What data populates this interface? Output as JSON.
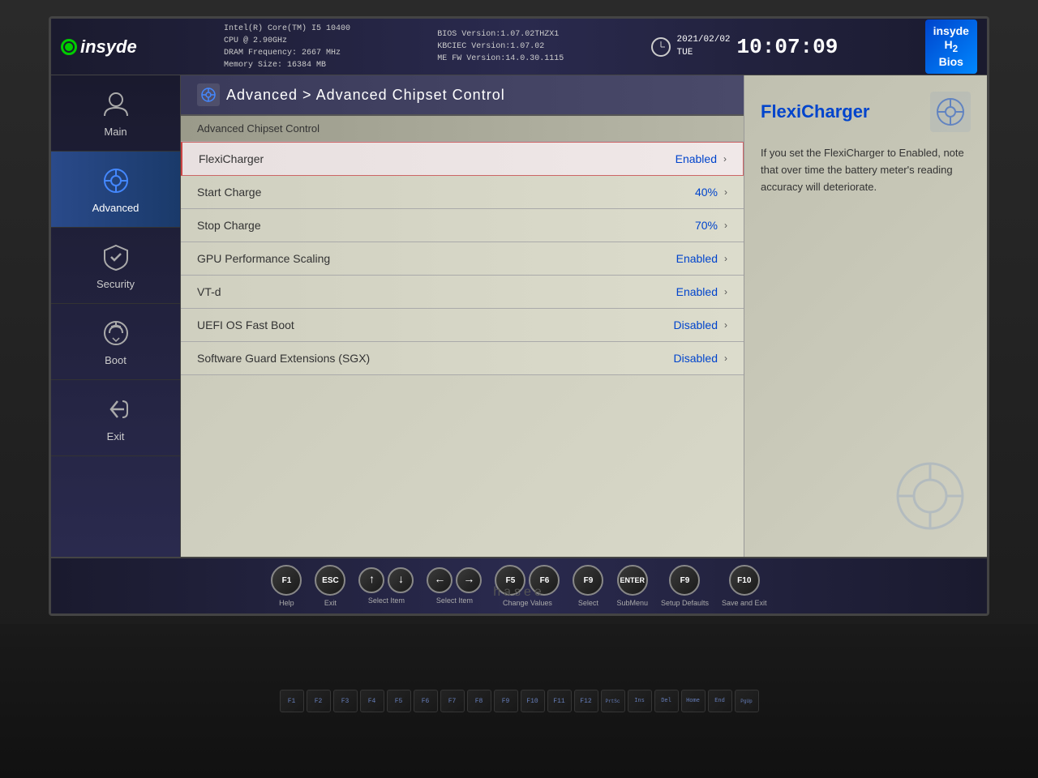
{
  "header": {
    "logo_text": "insyde",
    "cpu_info": {
      "line1": "Intel(R) Core(TM) I5 10400",
      "line2": "CPU @ 2.90GHz",
      "line3": "DRAM Frequency: 2667 MHz",
      "line4": "Memory Size: 16384 MB"
    },
    "bios_info": {
      "line1": "BIOS Version:1.07.02THZX1",
      "line2": "KBCIEC Version:1.07.02",
      "line3": "ME FW Version:14.0.30.1115"
    },
    "date": "2021/02/02",
    "day": "TUE",
    "time": "10:07:09",
    "h2bios": "insyde\nH₂\nBios"
  },
  "sidebar": {
    "items": [
      {
        "id": "main",
        "label": "Main",
        "active": false
      },
      {
        "id": "advanced",
        "label": "Advanced",
        "active": true
      },
      {
        "id": "security",
        "label": "Security",
        "active": false
      },
      {
        "id": "boot",
        "label": "Boot",
        "active": false
      },
      {
        "id": "exit",
        "label": "Exit",
        "active": false
      }
    ]
  },
  "breadcrumb": {
    "path": "Advanced > Advanced Chipset Control"
  },
  "section": {
    "title": "Advanced Chipset Control"
  },
  "settings": [
    {
      "name": "FlexiCharger",
      "value": "Enabled",
      "selected": true
    },
    {
      "name": "Start Charge",
      "value": "40%",
      "selected": false
    },
    {
      "name": "Stop Charge",
      "value": "70%",
      "selected": false
    },
    {
      "name": "GPU Performance Scaling",
      "value": "Enabled",
      "selected": false
    },
    {
      "name": "VT-d",
      "value": "Enabled",
      "selected": false
    },
    {
      "name": "UEFI OS Fast Boot",
      "value": "Disabled",
      "selected": false
    },
    {
      "name": "Software Guard Extensions (SGX)",
      "value": "Disabled",
      "selected": false
    }
  ],
  "info_panel": {
    "title": "FlexiCharger",
    "description": "If you set the FlexiCharger to Enabled, note that over time the battery meter's reading accuracy will deteriorate."
  },
  "bottom_keys": [
    {
      "key": "F1",
      "label": "Help"
    },
    {
      "key": "ESC",
      "label": "Exit"
    },
    {
      "key": "↑↓",
      "label": "Select Item"
    },
    {
      "key": "←→",
      "label": "Select Item"
    },
    {
      "key": "F5F6",
      "label": "Change Values"
    },
    {
      "key": "F9",
      "label": "Select"
    },
    {
      "key": "ENTER",
      "label": "SubMenu"
    },
    {
      "key": "F9 ",
      "label": "Setup Defaults"
    },
    {
      "key": "F10",
      "label": "Save and Exit"
    }
  ],
  "brand": "hasee",
  "icons": {
    "main": "👤",
    "advanced": "🔍",
    "security": "🛡",
    "boot": "⏻",
    "exit": "↩"
  }
}
